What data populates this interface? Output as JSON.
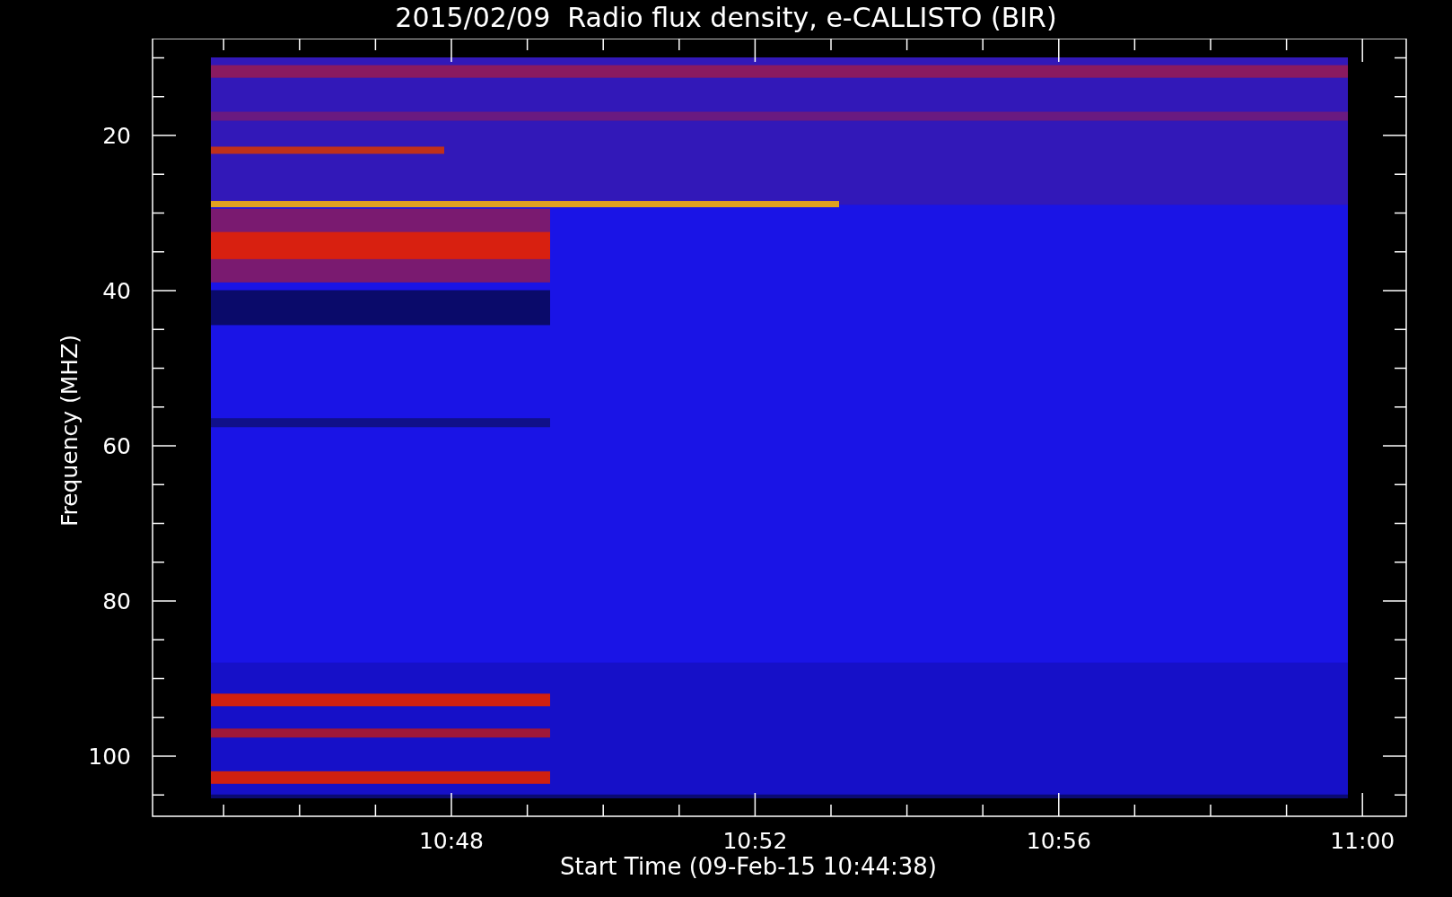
{
  "title": "2015/02/09  Radio flux density, e-CALLISTO (BIR)",
  "ylabel": "Frequency (MHZ)",
  "yticks": [
    "20",
    "40",
    "60",
    "80",
    "100"
  ],
  "xticks": [
    "10:48",
    "10:52",
    "10:56",
    "11:00"
  ],
  "xlabel": "Start Time (09-Feb-15 10:44:38)",
  "spectrogram": {
    "kind": "picture"
  }
}
